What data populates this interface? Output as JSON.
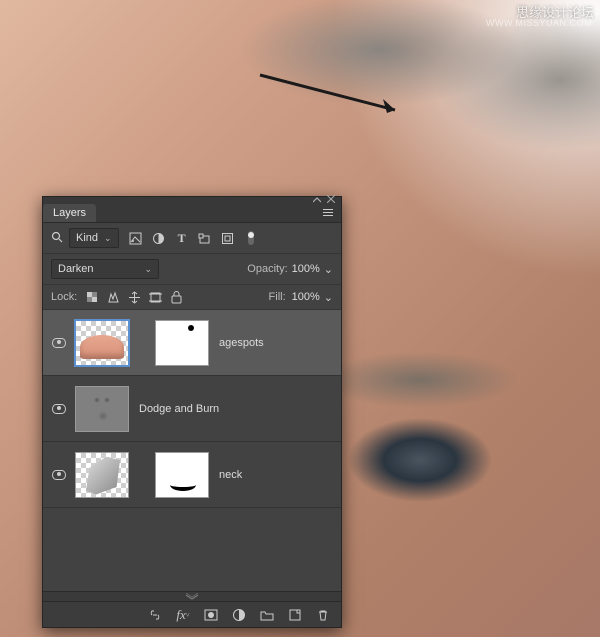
{
  "watermark": {
    "title": "思缘设计论坛",
    "sub": "WWW.MISSYUAN.COM"
  },
  "panel": {
    "title": "Layers",
    "filter": {
      "kind_label": "Kind"
    },
    "blend": {
      "mode": "Darken",
      "opacity_label": "Opacity:",
      "opacity_value": "100%"
    },
    "lock": {
      "label": "Lock:",
      "fill_label": "Fill:",
      "fill_value": "100%"
    },
    "layers": [
      {
        "name": "agespots",
        "selected": true,
        "visible": true
      },
      {
        "name": "Dodge and Burn",
        "selected": false,
        "visible": true
      },
      {
        "name": "neck",
        "selected": false,
        "visible": true
      }
    ]
  }
}
